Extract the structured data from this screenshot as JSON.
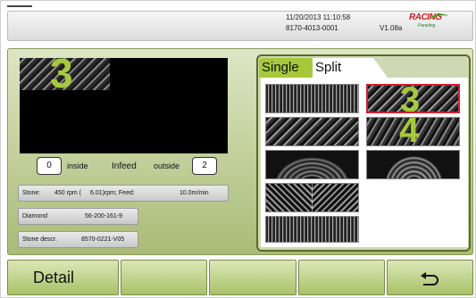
{
  "header": {
    "datetime": "11/20/2013 11:10:58",
    "serial": "8170-4013-0001",
    "version": "V1.08a",
    "logo_text": "RACING",
    "logo_sub": "Paneling"
  },
  "preview": {
    "pattern_number": "3",
    "inside_value": "0",
    "inside_label": "inside",
    "infeed_label": "Infeed",
    "outside_label": "outside",
    "outside_value": "2"
  },
  "info": {
    "stone_label": "Stone:",
    "stone_rpm": "450 rpm (",
    "stone_detail": "6.01)rpm; Feed:",
    "feed_value": "10.0m/min",
    "diamond_label": "Diamond",
    "diamond_value": "56-200-161-9",
    "descr_label": "Stone descr.",
    "descr_value": "8570-0221-V05"
  },
  "selector": {
    "tabs": [
      {
        "label": "Single",
        "active": true
      },
      {
        "label": "Split",
        "active": false
      }
    ],
    "selected_pattern": "3",
    "second_pattern": "4"
  },
  "bottom_bar": {
    "detail_label": "Detail",
    "back_icon": "undo-arrow-icon"
  },
  "colors": {
    "accent_green": "#a6c93c",
    "selected_border": "#d02030",
    "panel_green": "#aabb77"
  }
}
